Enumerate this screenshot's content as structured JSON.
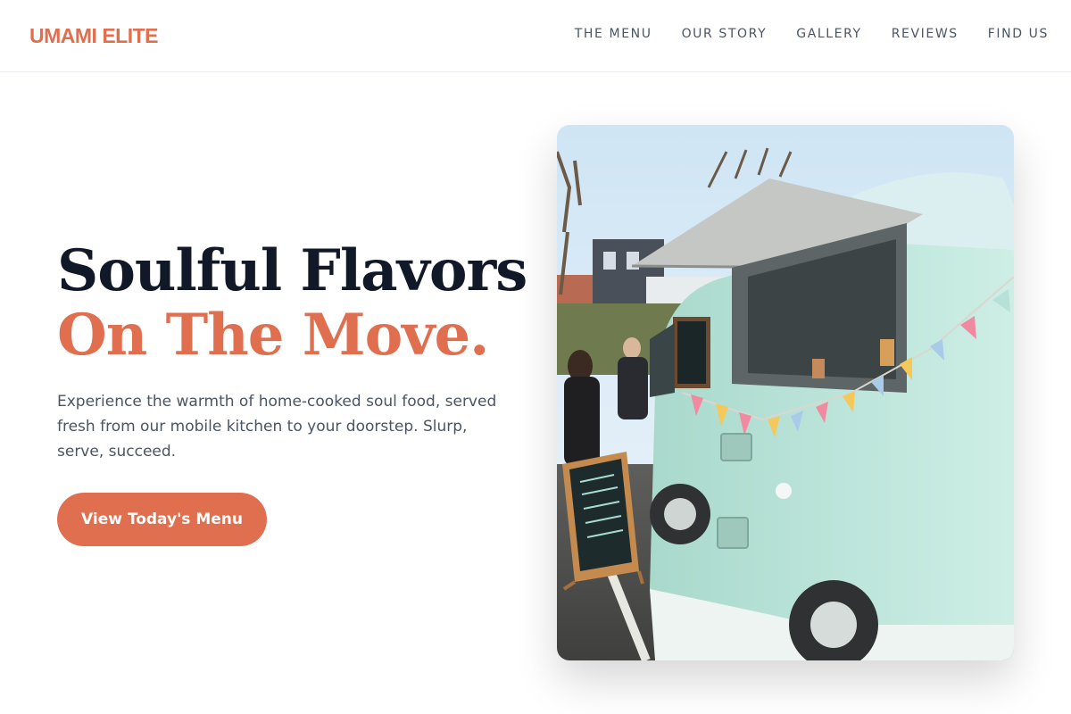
{
  "brand": {
    "name": "UMAMI ELITE",
    "color": "#e06f50"
  },
  "nav": {
    "items": [
      {
        "label": "THE MENU"
      },
      {
        "label": "OUR STORY"
      },
      {
        "label": "GALLERY"
      },
      {
        "label": "REVIEWS"
      },
      {
        "label": "FIND US"
      }
    ]
  },
  "hero": {
    "title_line1": "Soulful Flavors",
    "title_line2": "On The Move.",
    "description": "Experience the warmth of home-cooked soul food, served fresh from our mobile kitchen to your doorstep. Slurp, serve, succeed.",
    "cta_label": "View Today's Menu",
    "image_alt": "Mint green food truck van with bunting flags and chalkboard sign"
  },
  "colors": {
    "accent": "#e06f50",
    "heading": "#111827",
    "body_text": "#4b5563",
    "truck": "#b9e3d8"
  }
}
